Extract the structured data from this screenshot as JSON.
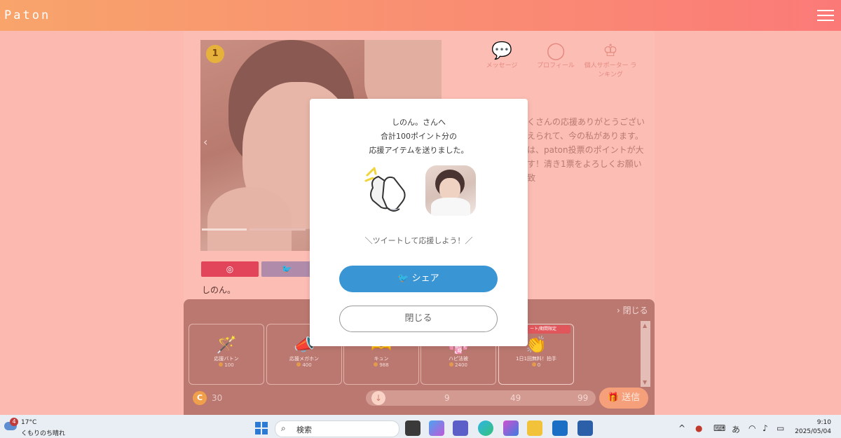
{
  "app": {
    "logo": "Paton"
  },
  "profile": {
    "rank_badge": "1",
    "nav": [
      {
        "icon": "message-icon",
        "label": "メッセージ"
      },
      {
        "icon": "profile-icon",
        "label": "プロフィール"
      },
      {
        "icon": "crown-icon",
        "label": "個人サポーター ランキング"
      }
    ],
    "bio_lines": [
      "くさんの応援ありがとうござい",
      "えられて、今の私があります。",
      "は、paton投票のポイントが大",
      "す！清き1票をよろしくお願い致"
    ],
    "social": {
      "instagram_icon": "instagram-icon",
      "twitter_icon": "twitter-icon"
    },
    "name": "しのん。"
  },
  "panel": {
    "close_label": "閉じる",
    "items": [
      {
        "name": "応援バトン",
        "points": "100",
        "icon": "baton-icon"
      },
      {
        "name": "応援メガホン",
        "points": "400",
        "icon": "megaphone-icon"
      },
      {
        "name": "キュン",
        "points": "988",
        "icon": "heart-hand-icon"
      },
      {
        "name": "ハピ法被",
        "points": "2400",
        "icon": "happi-icon"
      },
      {
        "name": "1日1回無料！拍手",
        "points": "0",
        "icon": "clap-icon",
        "tag": "ート/期間限定"
      }
    ],
    "coin_symbol": "C",
    "coin_count": "30",
    "slider_ticks": [
      "9",
      "49",
      "99"
    ],
    "send_label": "送信"
  },
  "modal": {
    "message_line1": "しのん。さんへ",
    "message_line2": "合計100ポイント分の",
    "message_line3": "応援アイテムを送りました。",
    "tweet_prompt": "＼ツイートして応援しよう！／",
    "share_label": "シェア",
    "close_label": "閉じる"
  },
  "taskbar": {
    "weather_temp": "17°C",
    "weather_cond": "くもりのち晴れ",
    "weather_badge": "4",
    "search_label": "検索",
    "ime": "あ",
    "time": "9:10",
    "date": "2025/05/04"
  },
  "colors": {
    "header_start": "#f8a46b",
    "header_end": "#fb7a78",
    "share_button": "#3a95d4",
    "overlay": "#fbb9b0"
  }
}
